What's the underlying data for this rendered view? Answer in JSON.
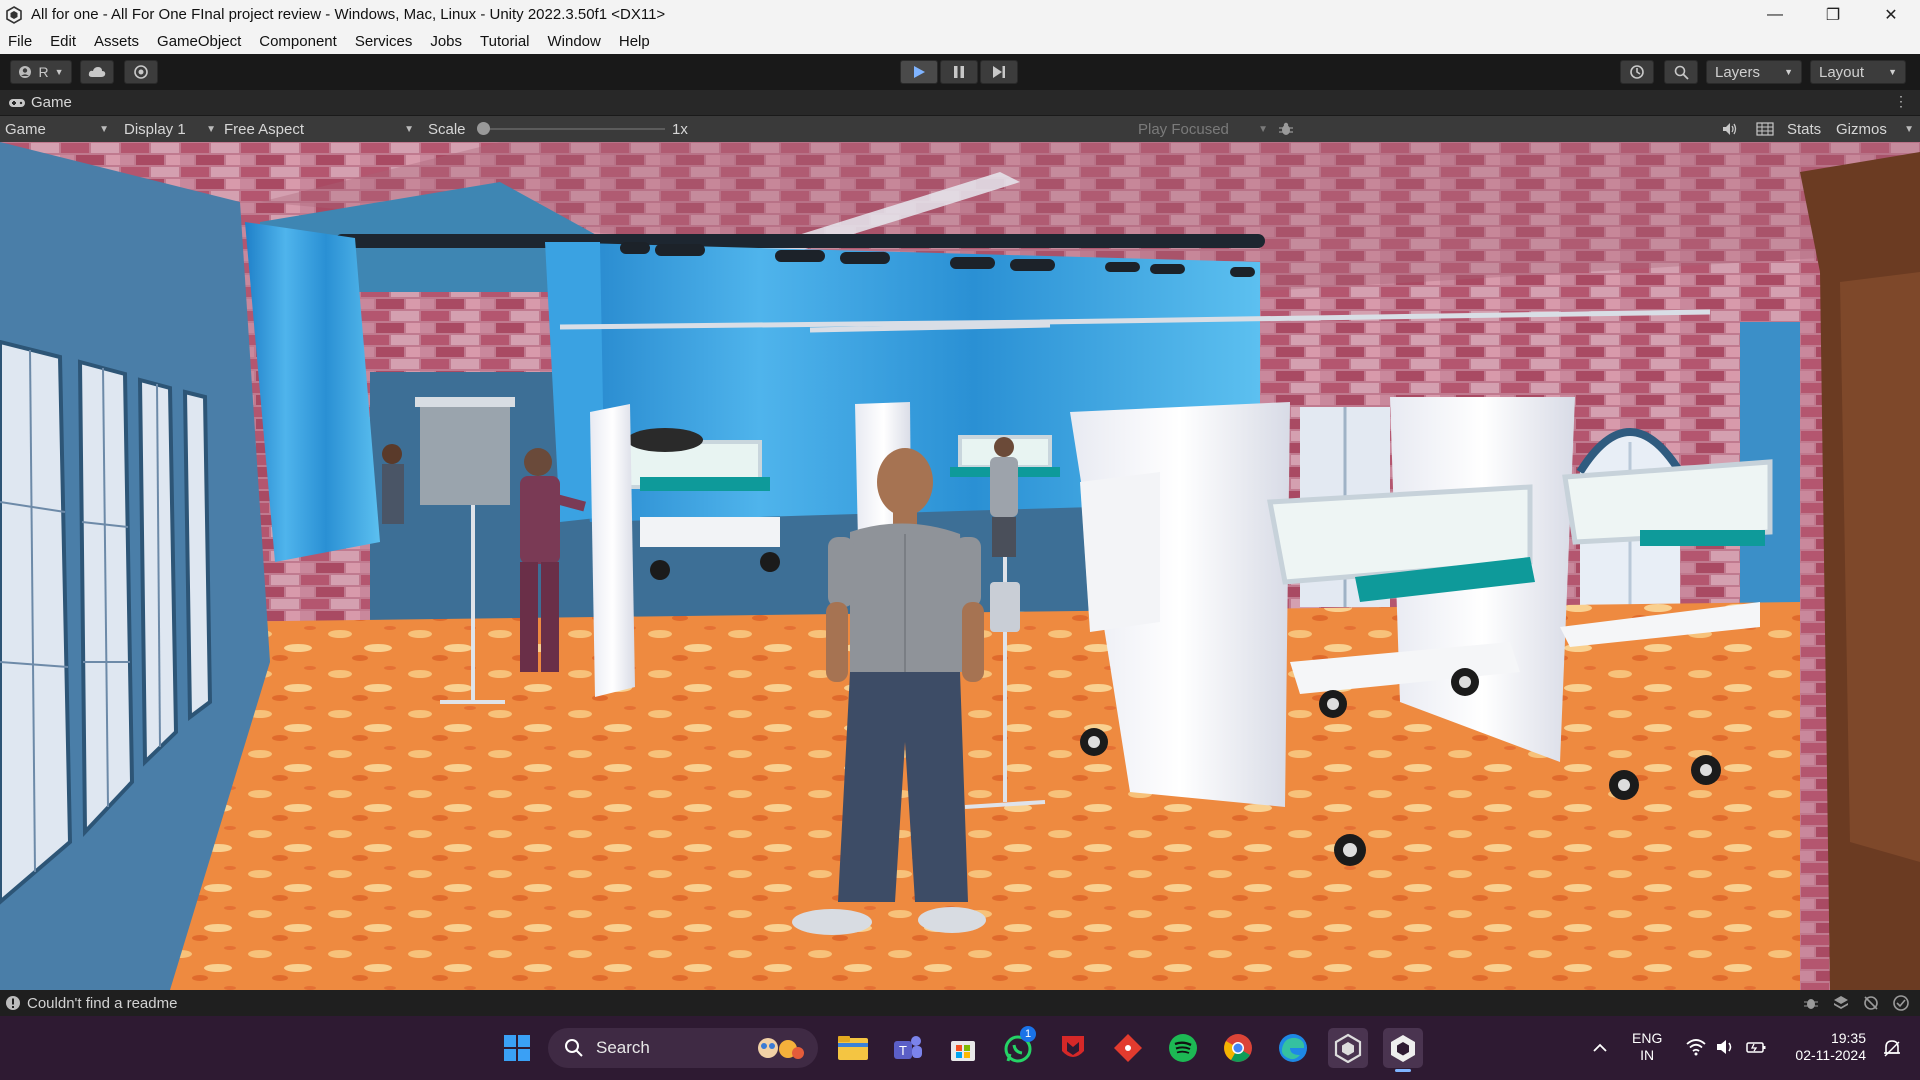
{
  "window": {
    "title": "All for one - All For One FInal project review - Windows, Mac, Linux - Unity 2022.3.50f1 <DX11>",
    "minimize": "—",
    "restore": "❐",
    "close": "✕"
  },
  "menu": [
    "File",
    "Edit",
    "Assets",
    "GameObject",
    "Component",
    "Services",
    "Jobs",
    "Tutorial",
    "Window",
    "Help"
  ],
  "toolbar": {
    "account_label": "R",
    "layers_label": "Layers",
    "layout_label": "Layout"
  },
  "tab": {
    "label": "Game"
  },
  "game_toolbar": {
    "mode": "Game",
    "display": "Display 1",
    "aspect": "Free Aspect",
    "scale_label": "Scale",
    "scale_value": "1x",
    "play_focused": "Play Focused",
    "stats": "Stats",
    "gizmos": "Gizmos"
  },
  "status": {
    "message": "Couldn't find a readme"
  },
  "taskbar": {
    "search_placeholder": "Search",
    "whatsapp_badge": "1",
    "lang_line1": "ENG",
    "lang_line2": "IN",
    "time": "19:35",
    "date": "02-11-2024"
  },
  "colors": {
    "editor_bg": "#191919",
    "toolbar_bg": "#3a3a3a",
    "taskbar_bg": "#2e1a32",
    "play_blue": "#7fb4ff",
    "floor_orange": "#f08a3c",
    "curtain_blue": "#3aa0e0",
    "brick_pink": "#c47f93"
  },
  "icons": [
    "unity-logo-icon",
    "account-icon",
    "cloud-icon",
    "collab-icon",
    "play-icon",
    "pause-icon",
    "step-icon",
    "history-icon",
    "search-icon",
    "gamepad-icon",
    "more-icon",
    "bug-icon",
    "audio-icon",
    "grid-icon",
    "info-icon",
    "windows-start-icon",
    "explorer-icon",
    "teams-icon",
    "store-icon",
    "whatsapp-icon",
    "mcafee-icon",
    "git-icon",
    "spotify-icon",
    "chrome-icon",
    "edge-icon",
    "unity-hub-icon",
    "unity-editor-icon",
    "chevron-up-icon",
    "wifi-icon",
    "volume-icon",
    "battery-icon",
    "notification-icon"
  ]
}
